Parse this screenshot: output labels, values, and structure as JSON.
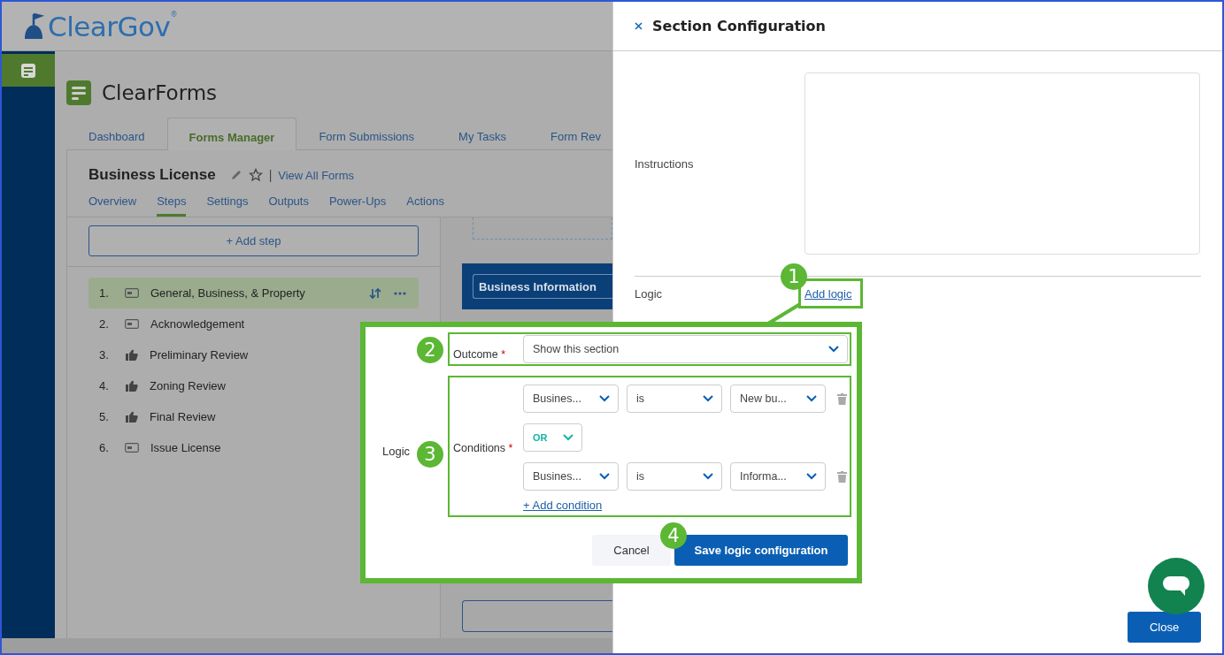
{
  "header": {
    "logo_text": "ClearGov",
    "logo_mark": "®"
  },
  "app": {
    "title": "ClearForms",
    "tabs": [
      {
        "label": "Dashboard",
        "selected": false
      },
      {
        "label": "Forms Manager",
        "selected": true
      },
      {
        "label": "Form Submissions",
        "selected": false
      },
      {
        "label": "My Tasks",
        "selected": false
      },
      {
        "label": "Form Rev",
        "selected": false
      }
    ]
  },
  "form": {
    "title": "Business License",
    "separator": "|",
    "view_all_link": "View All Forms",
    "subtabs": [
      {
        "label": "Overview",
        "selected": false
      },
      {
        "label": "Steps",
        "selected": true
      },
      {
        "label": "Settings",
        "selected": false
      },
      {
        "label": "Outputs",
        "selected": false
      },
      {
        "label": "Power-Ups",
        "selected": false
      },
      {
        "label": "Actions",
        "selected": false
      }
    ],
    "add_step_button": "+ Add step",
    "steps": [
      {
        "number": "1.",
        "label": "General, Business, & Property",
        "kind": "section",
        "selected": true
      },
      {
        "number": "2.",
        "label": "Acknowledgement",
        "kind": "section",
        "selected": false
      },
      {
        "number": "3.",
        "label": "Preliminary Review",
        "kind": "review",
        "selected": false
      },
      {
        "number": "4.",
        "label": "Zoning Review",
        "kind": "review",
        "selected": false
      },
      {
        "number": "5.",
        "label": "Final Review",
        "kind": "review",
        "selected": false
      },
      {
        "number": "6.",
        "label": "Issue License",
        "kind": "section",
        "selected": false
      }
    ]
  },
  "preview": {
    "section_title": "Business Information"
  },
  "drawer": {
    "title": "Section Configuration",
    "instructions_label": "Instructions",
    "logic_label": "Logic",
    "add_logic_link": "Add logic",
    "close_button": "Close"
  },
  "logic_popup": {
    "label": "Logic",
    "required_mark": "*",
    "outcome": {
      "label": "Outcome",
      "value": "Show this section"
    },
    "conditions": {
      "label": "Conditions",
      "rows": [
        {
          "field": "Busines...",
          "operator": "is",
          "value": "New bu..."
        },
        {
          "field": "Busines...",
          "operator": "is",
          "value": "Informa..."
        }
      ],
      "joiner": "OR",
      "add_link": "+ Add condition"
    },
    "cancel_button": "Cancel",
    "save_button": "Save logic configuration"
  },
  "callouts": [
    "1",
    "2",
    "3",
    "4"
  ]
}
